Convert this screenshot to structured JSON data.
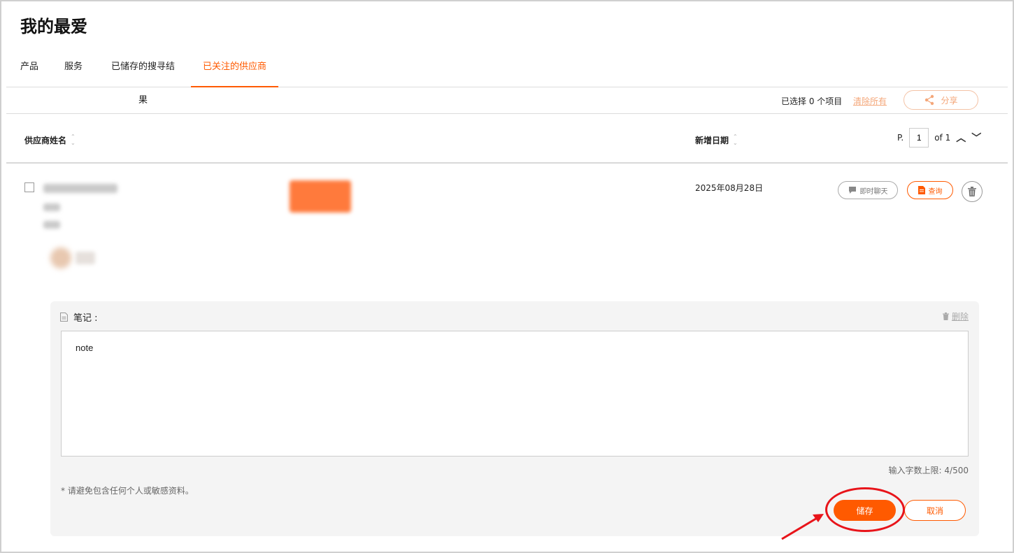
{
  "page": {
    "title": "我的最爱"
  },
  "tabs": [
    {
      "label": "产品",
      "active": false
    },
    {
      "label": "服务",
      "active": false
    },
    {
      "label": "已储存的搜寻结果",
      "active": false
    },
    {
      "label": "已关注的供应商",
      "active": true
    }
  ],
  "toolbar": {
    "selected_text": "已选择 0 个项目",
    "clear_all": "清除所有",
    "share": "分享"
  },
  "table": {
    "col_supplier": "供应商姓名",
    "col_date": "新增日期",
    "pager": {
      "prefix": "P.",
      "current": "1",
      "of": "of 1"
    }
  },
  "row": {
    "added_date": "2025年08月28日",
    "chat_label": "即时聊天",
    "inquiry_label": "查询"
  },
  "note": {
    "label": "笔记 :",
    "delete": "删除",
    "value": "note",
    "char_limit": "输入字数上限:  4/500",
    "privacy": "* 请避免包含任何个人或敏感资料。",
    "save": "储存",
    "cancel": "取消"
  },
  "colors": {
    "accent": "#ff5a00",
    "annotation": "#e8141a"
  }
}
